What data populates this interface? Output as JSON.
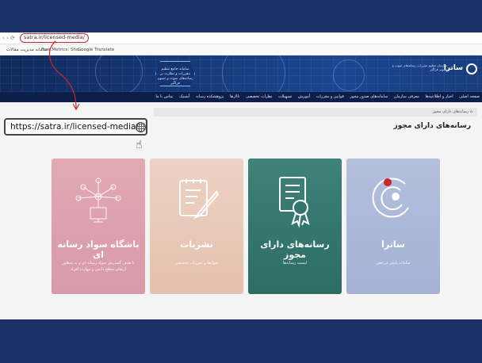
{
  "browser": {
    "url": "satra.ir/licensed-media/",
    "bookmarks": [
      "سامانه مدیریت مقالات ...",
      "Free Metrics: Sho...",
      "Google Translate"
    ]
  },
  "banner": {
    "badge_text": "سامانه جامع تنظیم مقررات و نظارت بر رسانه‌های صوت و تصویر فراگیر",
    "logo_name": "ساترا",
    "logo_subtitle": "سازمان تنظیم مقررات رسانه‌های صوت و تصویر فراگیر"
  },
  "menu": [
    "صفحه اصلی",
    "اخبار و اطلاعیه‌ها",
    "معرفی سازمان",
    "سامانه‌های صدور مجوز",
    "قوانین و مقررات",
    "آموزش",
    "تسهیلات",
    "نظرات تخصصی",
    "تالارها",
    "پژوهشکده رسانه",
    "آیسیک",
    "تماس با ما"
  ],
  "breadcrumb": "رسانه‌های دارای مجوز",
  "page_title": "رسانه‌های دارای مجوز",
  "callout": {
    "url": "https://satra.ir/licensed-media/"
  },
  "cards": [
    {
      "title": "باشگاه سواد رسانه ای",
      "desc": "با هدف گسترش سواد رسانه ای و به منظور ارتقای سطح دانش و مهارت افراد",
      "color": "#dc9fab"
    },
    {
      "title": "نشریات",
      "desc": "ضوابط و مقررات تخصصی",
      "color": "#e8c7b5"
    },
    {
      "title": "رسانه‌های دارای مجوز",
      "desc": "لیست رسانه‌ها",
      "color": "#34766d"
    },
    {
      "title": "ساترا",
      "desc": "سامانه پایش مرجعی",
      "color": "#abb8d8"
    }
  ],
  "colors": {
    "page_bg": "#1d3269",
    "banner": "#16397a",
    "menu": "#0c1f4a",
    "highlight": "#d0262a"
  }
}
